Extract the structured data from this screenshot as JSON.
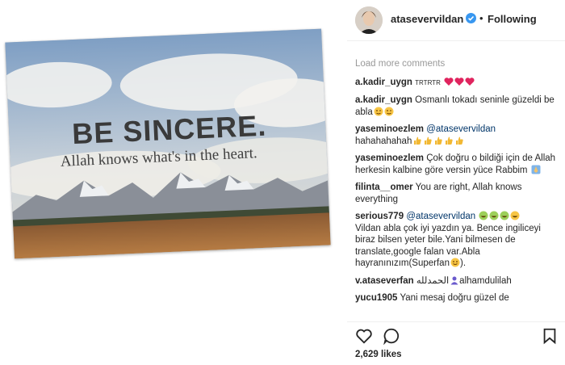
{
  "post": {
    "image_quote": "BE SINCERE.",
    "image_subquote": "Allah knows what's in the heart."
  },
  "header": {
    "username": "atasevervildan",
    "separator": "•",
    "follow_status": "Following",
    "verified_icon": "verified-badge-icon"
  },
  "comments": {
    "load_more": "Load more comments",
    "items": [
      {
        "user": "a.kadir_uygn",
        "text": "TRTRTR",
        "emoji": "hearts"
      },
      {
        "user": "a.kadir_uygn",
        "text": "Osmanlı tokadı seninle güzeldi be abla",
        "emoji": "wink"
      },
      {
        "user": "yaseminoezlem",
        "mention": "@atasevervildan",
        "text": "hahahahahah",
        "emoji": "thumbs"
      },
      {
        "user": "yaseminoezlem",
        "text": "Çok doğru o bildiği için de Allah herkesin kalbine göre versin yüce Rabbim",
        "emoji": "pray"
      },
      {
        "user": "filinta__omer",
        "text": "You are right, Allah knows everything"
      },
      {
        "user": "serious779",
        "mention": "@atasevervildan",
        "text": "Vildan abla çok iyi yazdın ya. Bence ingiliceyi biraz bilsen yeter bile.Yani bilmesen de translate,google falan var.Abla hayranınızım(Superfan",
        "text_end": ")."
      },
      {
        "user": "v.ataseverfan",
        "text_pre": "الحمدلله",
        "text": "alhamdulilah"
      },
      {
        "user": "yucu1905",
        "text": "Yani mesaj doğru güzel de"
      }
    ]
  },
  "actions": {
    "like_icon": "heart-icon",
    "comment_icon": "comment-icon",
    "save_icon": "bookmark-icon",
    "likes": "2,629 likes"
  }
}
